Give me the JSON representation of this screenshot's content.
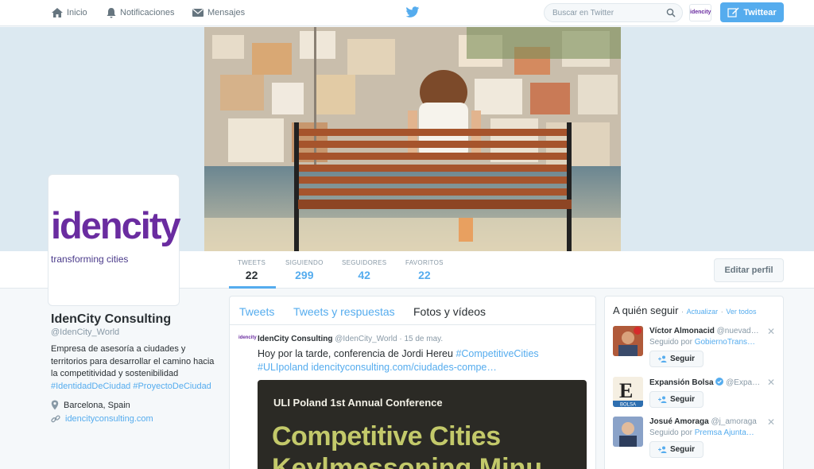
{
  "nav": {
    "home": "Inicio",
    "notifications": "Notificaciones",
    "messages": "Mensajes",
    "search_placeholder": "Buscar en Twitter",
    "tweet_button": "Twittear",
    "avatar_mini": "idencity"
  },
  "stats": [
    {
      "label": "TWEETS",
      "value": "22"
    },
    {
      "label": "SIGUIENDO",
      "value": "299"
    },
    {
      "label": "SEGUIDORES",
      "value": "42"
    },
    {
      "label": "FAVORITOS",
      "value": "22"
    }
  ],
  "edit_profile": "Editar perfil",
  "avatar": {
    "logo": "idencity",
    "tagline": "transforming cities"
  },
  "profile": {
    "name": "IdenCity Consulting",
    "handle": "@IdenCity_World",
    "bio": "Empresa de asesoría a ciudades y territorios para desarrollar el camino hacia la competitividad y sostenibilidad",
    "bio_tags": "#IdentidadDeCiudad #ProyectoDeCiudad",
    "location": "Barcelona, Spain",
    "website": "idencityconsulting.com"
  },
  "tabs": [
    "Tweets",
    "Tweets y respuestas",
    "Fotos y vídeos"
  ],
  "tweet": {
    "author": "IdenCity Consulting",
    "handle": "@IdenCity_World",
    "date": "· 15 de may.",
    "text": "Hoy por la tarde, conferencia de Jordi Hereu",
    "hashtag1": "#CompetitiveCities",
    "hashtag2": "#ULIpoland",
    "link": "idencityconsulting.com/ciudades-compe…",
    "media_line1": "ULI Poland 1st Annual Conference",
    "media_line2": "Competitive Cities",
    "media_line3": "Keylmessoning Minu"
  },
  "who_to_follow": {
    "title": "A quién seguir",
    "refresh": "Actualizar",
    "view_all": "Ver todos",
    "follow_label": "Seguir",
    "suggestions": [
      {
        "name": "Víctor Almonacid",
        "handle": "@nuevad…",
        "by_label": "Seguido por",
        "by": "GobiernoTrans…"
      },
      {
        "name": "Expansión Bolsa",
        "handle": "@Expa…",
        "by_label": "",
        "by": ""
      },
      {
        "name": "Josué Amoraga",
        "handle": "@j_amoraga",
        "by_label": "Seguido por",
        "by": "Premsa Ajunta…"
      }
    ]
  },
  "colors": {
    "accent": "#55acee",
    "logo_purple": "#6a2ca0",
    "logo_blue": "#2f8fd6"
  }
}
